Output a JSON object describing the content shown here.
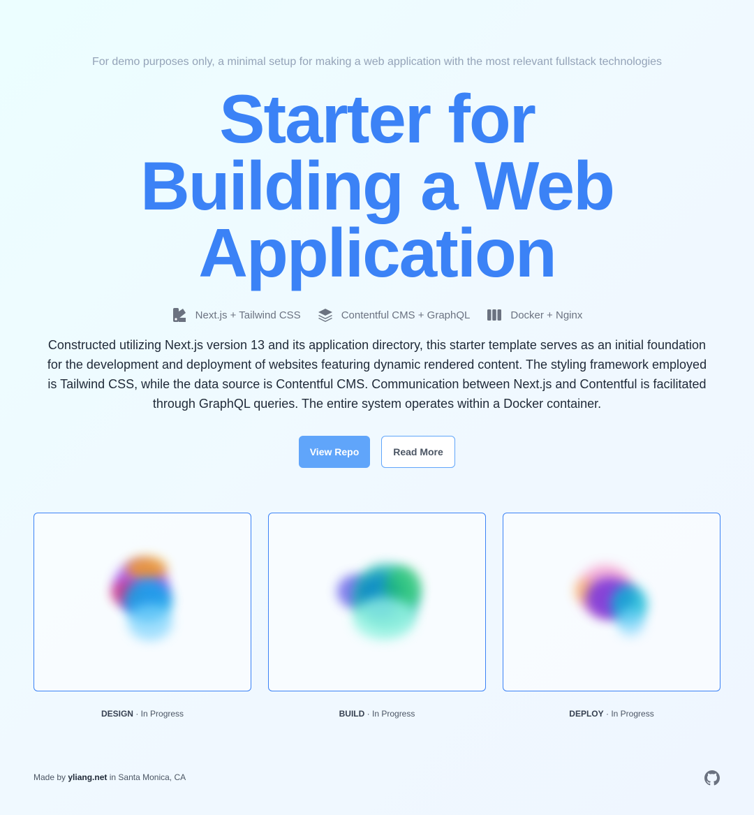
{
  "hero": {
    "tagline": "For demo purposes only, a minimal setup for making a web application with the most relevant fullstack technologies",
    "title_line1": "Starter for",
    "title_line2": "Building a Web",
    "title_line3": "Application"
  },
  "tech": [
    {
      "label": "Next.js + Tailwind CSS",
      "icon": "swatch-book-icon"
    },
    {
      "label": "Contentful CMS + GraphQL",
      "icon": "stack-layers-icon"
    },
    {
      "label": "Docker + Nginx",
      "icon": "columns-icon"
    }
  ],
  "description": "Constructed utilizing Next.js version 13 and its application directory, this starter template serves as an initial foundation for the development and deployment of websites featuring dynamic rendered content. The styling framework employed is Tailwind CSS, while the data source is Contentful CMS. Communication between Next.js and Contentful is facilitated through GraphQL queries. The entire system operates within a Docker container.",
  "buttons": {
    "primary": "View Repo",
    "secondary": "Read More"
  },
  "cards": [
    {
      "phase": "DESIGN",
      "status": "In Progress"
    },
    {
      "phase": "BUILD",
      "status": "In Progress"
    },
    {
      "phase": "DEPLOY",
      "status": "In Progress"
    }
  ],
  "separator": "·",
  "footer": {
    "prefix": "Made by",
    "author": "yliang.net",
    "suffix": "in Santa Monica, CA",
    "icon": "github-icon"
  },
  "colors": {
    "accent": "#3b82f6",
    "button": "#60a5fa",
    "muted": "#94a3b8"
  }
}
